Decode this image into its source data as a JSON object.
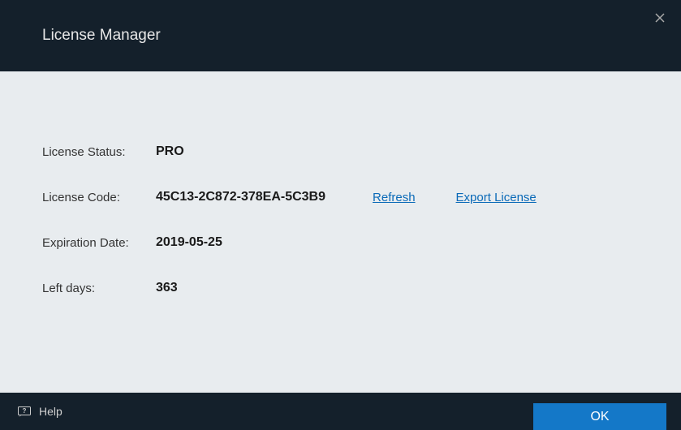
{
  "header": {
    "title": "License Manager"
  },
  "fields": {
    "status_label": "License Status:",
    "status_value": "PRO",
    "code_label": "License Code:",
    "code_value": "45C13-2C872-378EA-5C3B9",
    "expiration_label": "Expiration Date:",
    "expiration_value": "2019-05-25",
    "leftdays_label": "Left days:",
    "leftdays_value": "363"
  },
  "links": {
    "refresh": "Refresh",
    "export": "Export License"
  },
  "footer": {
    "help": "Help",
    "ok": "OK"
  }
}
